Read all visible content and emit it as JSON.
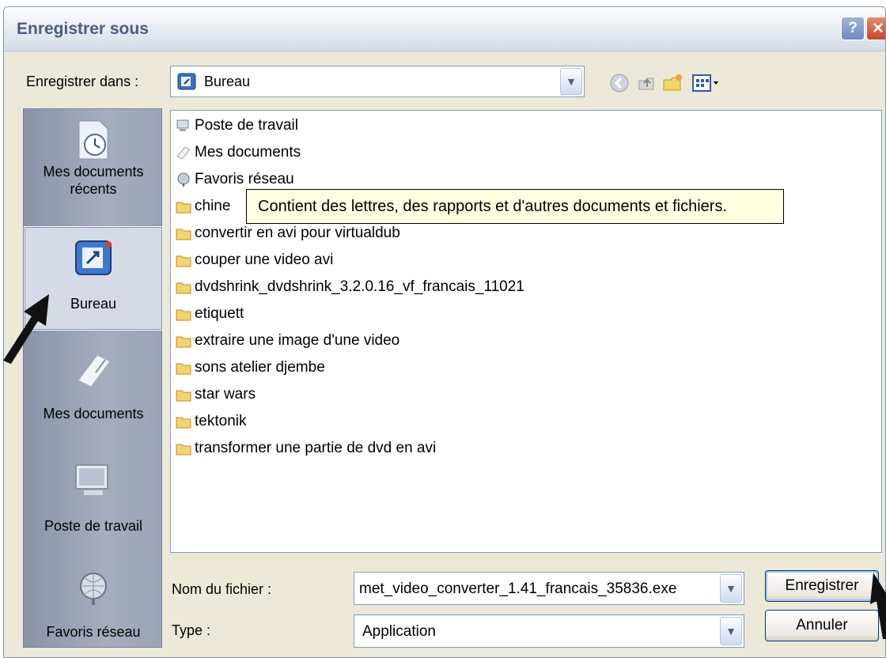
{
  "window": {
    "title": "Enregistrer sous",
    "help_label": "?",
    "close_label": "✕"
  },
  "save_in": {
    "label": "Enregistrer dans :",
    "value": "Bureau"
  },
  "toolbar": {
    "icons": [
      "back-icon",
      "up-folder-icon",
      "new-folder-icon",
      "view-menu-icon"
    ]
  },
  "places": [
    {
      "label_line1": "Mes documents",
      "label_line2": "récents",
      "icon": "recent-documents-icon"
    },
    {
      "label_line1": "Bureau",
      "label_line2": "",
      "icon": "desktop-icon",
      "active": true
    },
    {
      "label_line1": "Mes documents",
      "label_line2": "",
      "icon": "my-documents-icon"
    },
    {
      "label_line1": "Poste de travail",
      "label_line2": "",
      "icon": "my-computer-icon"
    },
    {
      "label_line1": "Favoris réseau",
      "label_line2": "",
      "icon": "network-places-icon"
    }
  ],
  "files": [
    {
      "name": "Poste de travail",
      "icon": "computer-icon"
    },
    {
      "name": "Mes documents",
      "icon": "documents-icon"
    },
    {
      "name": "Favoris réseau",
      "icon": "network-icon"
    },
    {
      "name": "chine",
      "icon": "folder-icon"
    },
    {
      "name": "convertir en avi pour virtualdub",
      "icon": "folder-icon"
    },
    {
      "name": "couper une video avi",
      "icon": "folder-icon"
    },
    {
      "name": "dvdshrink_dvdshrink_3.2.0.16_vf_francais_11021",
      "icon": "folder-icon"
    },
    {
      "name": "etiquett",
      "icon": "folder-icon"
    },
    {
      "name": "extraire une image d'une video",
      "icon": "folder-icon"
    },
    {
      "name": "sons atelier djembe",
      "icon": "folder-icon"
    },
    {
      "name": "star wars",
      "icon": "folder-icon"
    },
    {
      "name": "tektonik",
      "icon": "folder-icon"
    },
    {
      "name": "transformer une partie de dvd en avi",
      "icon": "folder-icon"
    }
  ],
  "tooltip": "Contient des lettres, des rapports et d'autres documents et fichiers.",
  "filename": {
    "label": "Nom du fichier :",
    "value": "met_video_converter_1.41_francais_35836.exe"
  },
  "filetype": {
    "label": "Type :",
    "value": "Application"
  },
  "buttons": {
    "save": "Enregistrer",
    "cancel": "Annuler"
  }
}
